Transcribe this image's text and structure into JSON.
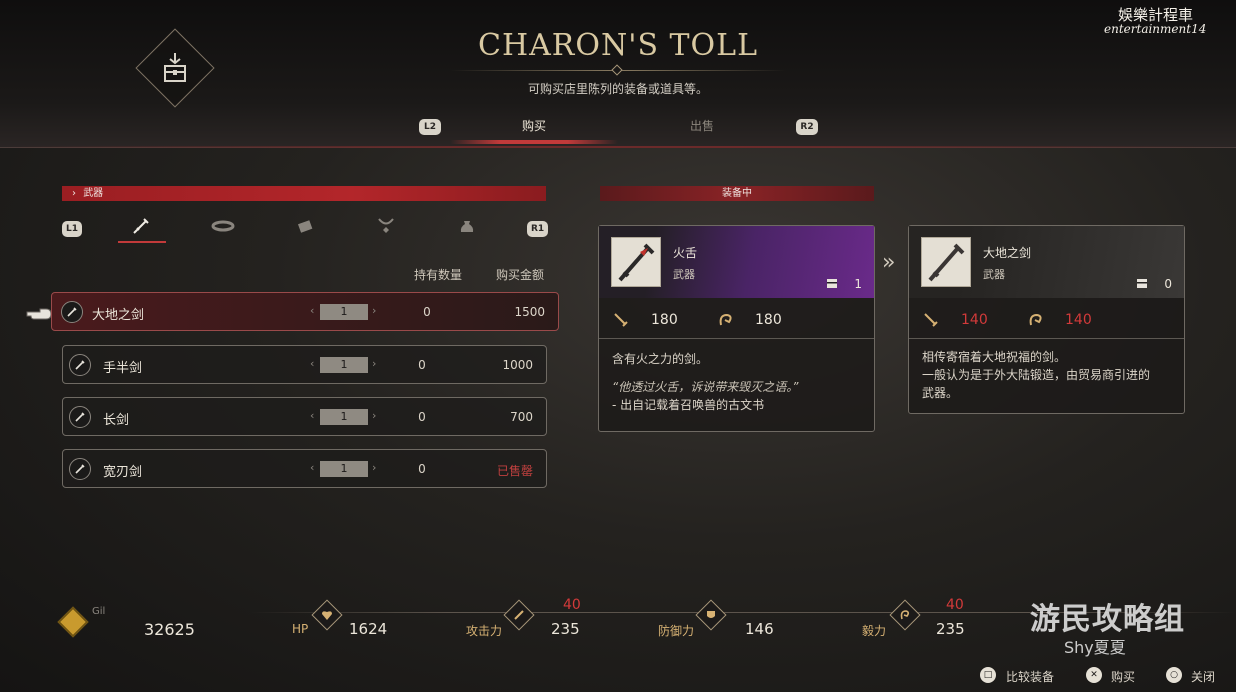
{
  "header": {
    "title": "CHARON'S TOLL",
    "subtitle": "可购买店里陈列的装备或道具等。",
    "left_trigger": "L2",
    "right_trigger": "R2",
    "tabs": [
      {
        "label": "购买",
        "active": true
      },
      {
        "label": "出售",
        "active": false
      }
    ]
  },
  "watermark": {
    "line1": "娛樂計程車",
    "line2": "entertainment14",
    "site": "游民攻略组",
    "author": "Shy夏夏"
  },
  "category": {
    "label": "武器",
    "left_bumper": "L1",
    "right_bumper": "R1",
    "icons": [
      "sword-icon",
      "bracelet-icon",
      "accessory-icon",
      "necklace-icon",
      "bag-icon"
    ]
  },
  "list": {
    "col_owned": "持有数量",
    "col_price": "购买金额",
    "items": [
      {
        "name": "大地之剑",
        "qty": "1",
        "owned": "0",
        "price": "1500",
        "selected": true
      },
      {
        "name": "手半剑",
        "qty": "1",
        "owned": "0",
        "price": "1000"
      },
      {
        "name": "长剑",
        "qty": "1",
        "owned": "0",
        "price": "700"
      },
      {
        "name": "宽刃剑",
        "qty": "1",
        "owned": "0",
        "price": "已售罄",
        "sold_out": true
      }
    ]
  },
  "equipped": {
    "label": "装备中",
    "name": "火舌",
    "type": "武器",
    "count": "1",
    "attack": "180",
    "willpower": "180",
    "desc": "含有火之力的剑。",
    "quote": "“他透过火舌，诉说带来毁灭之语。”",
    "source": "- 出自记载着召唤兽的古文书"
  },
  "compare": {
    "name": "大地之剑",
    "type": "武器",
    "count": "0",
    "attack": "140",
    "willpower": "140",
    "desc1": "相传寄宿着大地祝福的剑。",
    "desc2": "一般认为是于外大陆锻造，由贸易商引进的",
    "desc3": "武器。"
  },
  "footer": {
    "gil_label": "Gil",
    "gil": "32625",
    "hp_label": "HP",
    "hp": "1624",
    "atk_label": "攻击力",
    "atk": "235",
    "atk_delta": "40",
    "def_label": "防御力",
    "def": "146",
    "will_label": "毅力",
    "will": "235",
    "will_delta": "40"
  },
  "hints": [
    {
      "button": "□",
      "label": "比较装备"
    },
    {
      "button": "✕",
      "label": "购买"
    },
    {
      "button": "○",
      "label": "关闭"
    }
  ],
  "colors": {
    "accent_red": "#c23a3a",
    "stat_down": "#d23a3a",
    "gold_title": "#d9c9a2",
    "equipped_purple": "#5a2a78"
  }
}
